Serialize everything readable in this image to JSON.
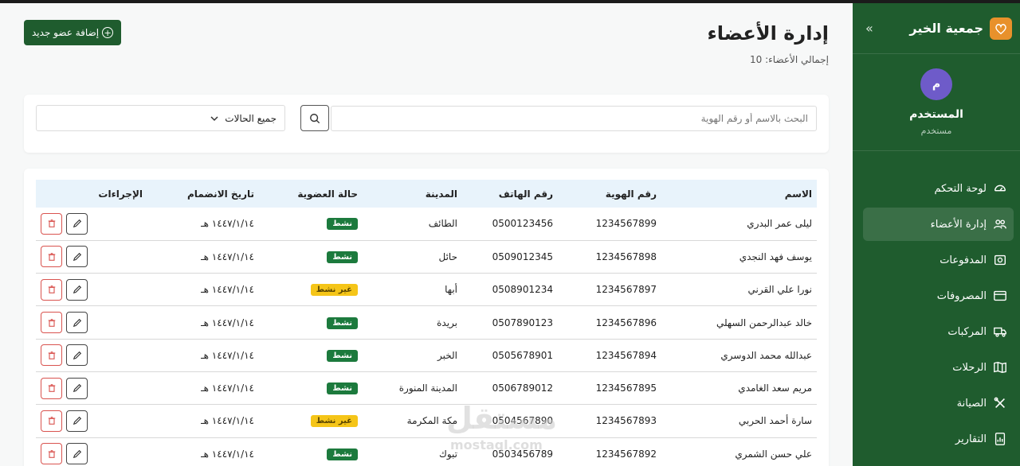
{
  "brand": {
    "name": "جمعية الخير",
    "accent": "#1f5c2e",
    "logo_color": "#e8912b"
  },
  "user": {
    "initial": "م",
    "name": "المستخدم",
    "role": "مستخدم"
  },
  "nav": [
    {
      "label": "لوحة التحكم",
      "icon": "dashboard-icon"
    },
    {
      "label": "إدارة الأعضاء",
      "icon": "users-icon",
      "active": true
    },
    {
      "label": "المدفوعات",
      "icon": "payments-icon"
    },
    {
      "label": "المصروفات",
      "icon": "card-icon"
    },
    {
      "label": "المركبات",
      "icon": "truck-icon"
    },
    {
      "label": "الرحلات",
      "icon": "map-icon"
    },
    {
      "label": "الصيانة",
      "icon": "tools-icon"
    },
    {
      "label": "التقارير",
      "icon": "report-icon"
    }
  ],
  "page": {
    "title": "إدارة الأعضاء",
    "subtitle": "إجمالي الأعضاء: 10",
    "add_button": "إضافة عضو جديد"
  },
  "filters": {
    "search_placeholder": "البحث بالاسم أو رقم الهوية",
    "status_value": "جميع الحالات"
  },
  "table": {
    "headers": {
      "name": "الاسم",
      "id": "رقم الهوية",
      "phone": "رقم الهاتف",
      "city": "المدينة",
      "status": "حالة العضوية",
      "date": "تاريخ الانضمام",
      "actions": "الإجراءات"
    },
    "rows": [
      {
        "name": "ليلى عمر البدري",
        "id": "1234567899",
        "phone": "0500123456",
        "city": "الطائف",
        "status": "نشط",
        "status_type": "active",
        "date": "١٤٤٧/١/١٤ هـ"
      },
      {
        "name": "يوسف فهد النجدي",
        "id": "1234567898",
        "phone": "0509012345",
        "city": "حائل",
        "status": "نشط",
        "status_type": "active",
        "date": "١٤٤٧/١/١٤ هـ"
      },
      {
        "name": "نورا علي القرني",
        "id": "1234567897",
        "phone": "0508901234",
        "city": "أبها",
        "status": "غير نشط",
        "status_type": "inactive",
        "date": "١٤٤٧/١/١٤ هـ"
      },
      {
        "name": "خالد عبدالرحمن السهلي",
        "id": "1234567896",
        "phone": "0507890123",
        "city": "بريدة",
        "status": "نشط",
        "status_type": "active",
        "date": "١٤٤٧/١/١٤ هـ"
      },
      {
        "name": "عبدالله محمد الدوسري",
        "id": "1234567894",
        "phone": "0505678901",
        "city": "الخبر",
        "status": "نشط",
        "status_type": "active",
        "date": "١٤٤٧/١/١٤ هـ"
      },
      {
        "name": "مريم سعد الغامدي",
        "id": "1234567895",
        "phone": "0506789012",
        "city": "المدينة المنورة",
        "status": "نشط",
        "status_type": "active",
        "date": "١٤٤٧/١/١٤ هـ"
      },
      {
        "name": "سارة أحمد الحربي",
        "id": "1234567893",
        "phone": "0504567890",
        "city": "مكة المكرمة",
        "status": "غير نشط",
        "status_type": "inactive",
        "date": "١٤٤٧/١/١٤ هـ"
      },
      {
        "name": "علي حسن الشمري",
        "id": "1234567892",
        "phone": "0503456789",
        "city": "تبوك",
        "status": "نشط",
        "status_type": "active",
        "date": "١٤٤٧/١/١٤ هـ"
      }
    ]
  },
  "watermark": {
    "text": "مستقل",
    "sub": "mostaql.com"
  }
}
